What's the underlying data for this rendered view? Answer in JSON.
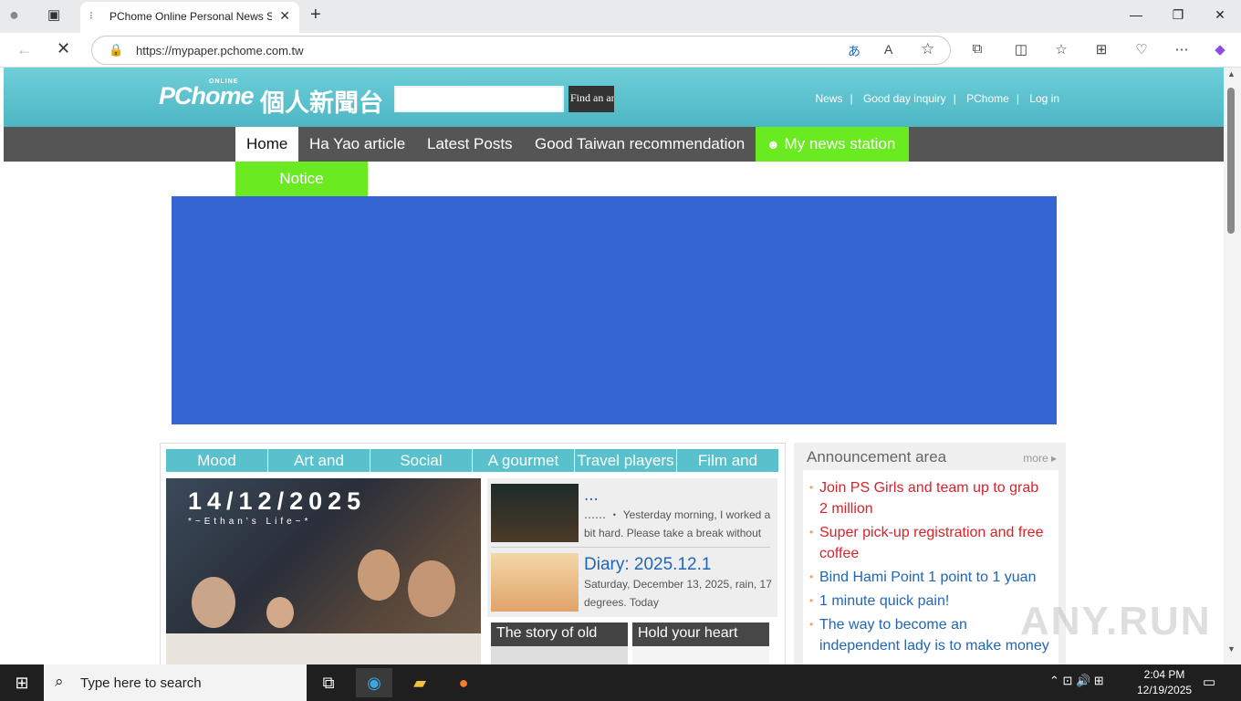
{
  "browser": {
    "tab_title": "PChome Online Personal News Station",
    "url": "https://mypaper.pchome.com.tw",
    "icons": [
      "profile-icon",
      "tab-actions-icon",
      "back-icon",
      "stop-icon",
      "translate-icon",
      "read-aloud-icon",
      "favorite-star-icon",
      "extensions-icon",
      "split-screen-icon",
      "favorites-icon",
      "collections-icon",
      "performance-icon",
      "more-icon",
      "copilot-icon"
    ]
  },
  "header": {
    "logo_text": "PChome",
    "logo_online": "ONLINE",
    "logo_cn": "個人新聞台",
    "search_placeholder": "",
    "search_button": "Find an article",
    "links": [
      "News",
      "Good day inquiry",
      "PChome",
      "Log in"
    ]
  },
  "nav": {
    "items": [
      "Home",
      "Ha Yao article",
      "Latest Posts",
      "Good Taiwan recommendation",
      "My news station"
    ],
    "notice": "Notice"
  },
  "categories": [
    "Mood",
    "Art and",
    "Social",
    "A gourmet",
    "Travel players",
    "Film and"
  ],
  "feature": {
    "date": "14/12/2025",
    "subtitle": "*~Ethan's Life~*"
  },
  "posts": [
    {
      "title": "...",
      "body": "‥‥‥ ・ Yesterday morning, I worked a bit hard. Please take a break without"
    },
    {
      "title": "Diary: 2025.12.1",
      "body": "Saturday, December 13, 2025, rain, 17 degrees. Today"
    }
  ],
  "cards": [
    "The story of old",
    "Hold your heart"
  ],
  "announcement": {
    "heading": "Announcement area",
    "more": "more",
    "items": [
      {
        "text": "Join PS Girls and team up to grab 2 million",
        "color": "red"
      },
      {
        "text": "Super pick-up registration and free coffee",
        "color": "red"
      },
      {
        "text": "Bind Hami Point 1 point to 1 yuan",
        "color": "blue"
      },
      {
        "text": "1 minute quick pain!",
        "color": "blue"
      },
      {
        "text": "The way to become an independent lady is to make money",
        "color": "blue"
      }
    ]
  },
  "taskbar": {
    "search_text": "Type here to search",
    "time": "2:04 PM",
    "date": "12/19/2025"
  },
  "watermark": "ANY.RUN",
  "colors": {
    "header": "#4db6c4",
    "nav": "#555555",
    "green": "#6aeb21",
    "banner": "#3465d3",
    "link_blue": "#2166b5",
    "red": "#d8232a"
  }
}
